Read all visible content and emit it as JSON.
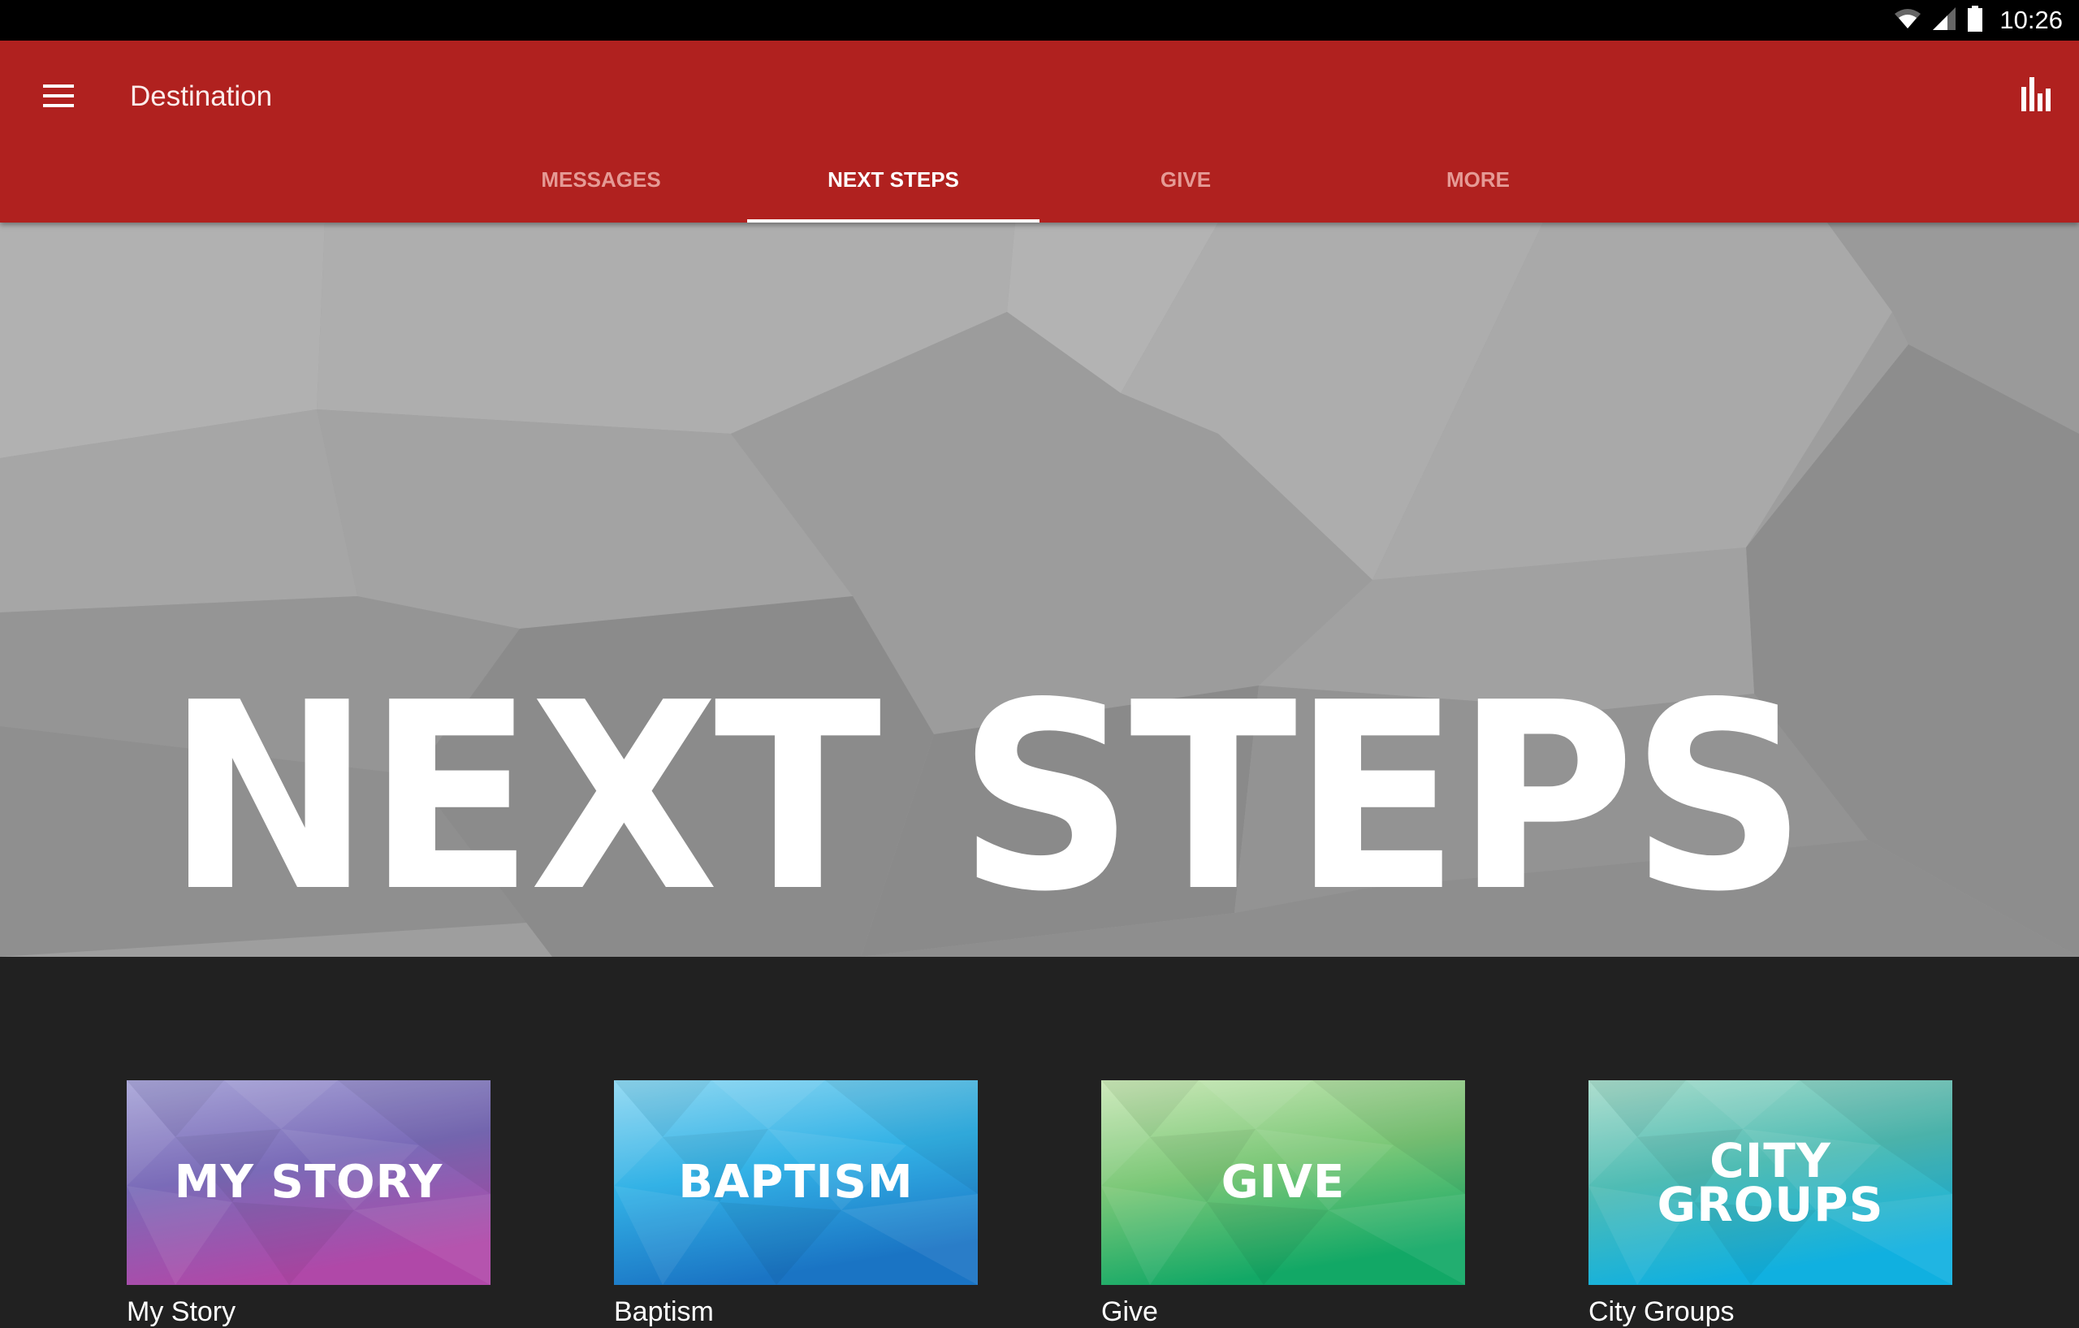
{
  "status_bar": {
    "time": "10:26",
    "icons": [
      "wifi-icon",
      "cell-signal-icon",
      "battery-icon"
    ]
  },
  "app_bar": {
    "title": "Destination",
    "menu_icon": "hamburger-menu-icon",
    "action_icon": "bar-chart-icon",
    "color": "#b0211f"
  },
  "tabs": [
    {
      "label": "MESSAGES",
      "active": false
    },
    {
      "label": "NEXT STEPS",
      "active": true
    },
    {
      "label": "GIVE",
      "active": false
    },
    {
      "label": "MORE",
      "active": false
    }
  ],
  "banner": {
    "title": "NEXT STEPS"
  },
  "cards": [
    {
      "image_text": "MY STORY",
      "label": "My Story",
      "colors": [
        "#a9a6d8",
        "#7a6bb8",
        "#b048a8"
      ]
    },
    {
      "image_text": "BAPTISM",
      "label": "Baptism",
      "colors": [
        "#8fd8f2",
        "#33b2e6",
        "#1a74c4"
      ]
    },
    {
      "image_text": "GIVE",
      "label": "Give",
      "colors": [
        "#cbe8b8",
        "#7cc878",
        "#12a866"
      ]
    },
    {
      "image_text": "CITY GROUPS",
      "label": "City Groups",
      "colors": [
        "#a8dccb",
        "#4fbcb4",
        "#10b0e0"
      ]
    }
  ]
}
